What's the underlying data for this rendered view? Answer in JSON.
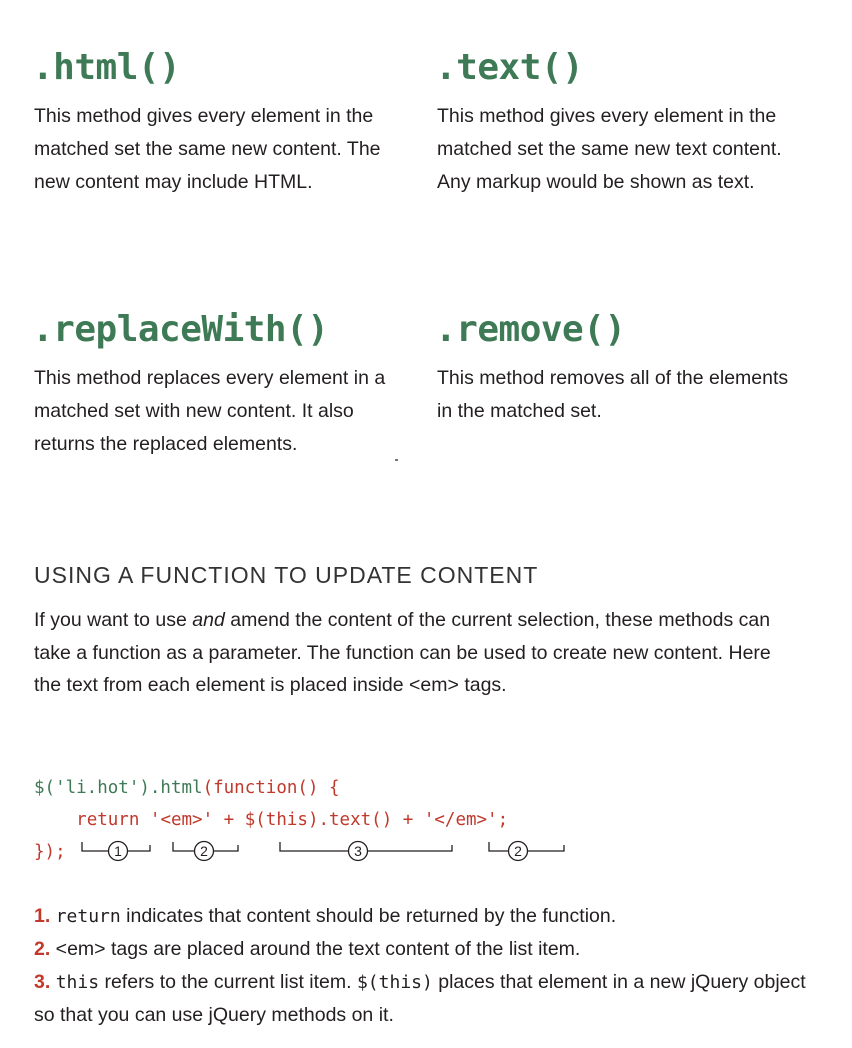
{
  "methods": [
    {
      "name": ".html()",
      "description": "This method gives every element in the matched set the same new content. The new content may include HTML."
    },
    {
      "name": ".text()",
      "description": "This method gives every element in the matched set the same new text content. Any markup would be shown as text."
    },
    {
      "name": ".replaceWith()",
      "description": "This method replaces every element in a matched set with new content. It also returns the replaced elements."
    },
    {
      "name": ".remove()",
      "description": "This method removes all of the elements in the matched set."
    }
  ],
  "section": {
    "heading": "USING A FUNCTION TO UPDATE CONTENT",
    "intro_before": "If you want to use ",
    "intro_em": "and",
    "intro_after": " amend the content of the current selection, these methods can take a function as a parameter. The function can be used to create new content. Here the text from each element is placed inside <em> tags."
  },
  "code": {
    "line1_selector": "$('li.hot').html",
    "line1_function": "(function() {",
    "line2": "return '<em>' + $(this).text() + '</em>';",
    "line3": "});"
  },
  "callouts": [
    "1",
    "2",
    "3",
    "2"
  ],
  "notes": [
    {
      "num": "1.",
      "code": "return",
      "text": " indicates that content should be returned by the function."
    },
    {
      "num": "2.",
      "text": " <em> tags are placed around the text content of the list item."
    },
    {
      "num": "3.",
      "code": "this",
      "text": " refers to the current list item. ",
      "code2": "$(this)",
      "text2": " places that element in a new jQuery object so that you can use jQuery methods on it."
    }
  ]
}
